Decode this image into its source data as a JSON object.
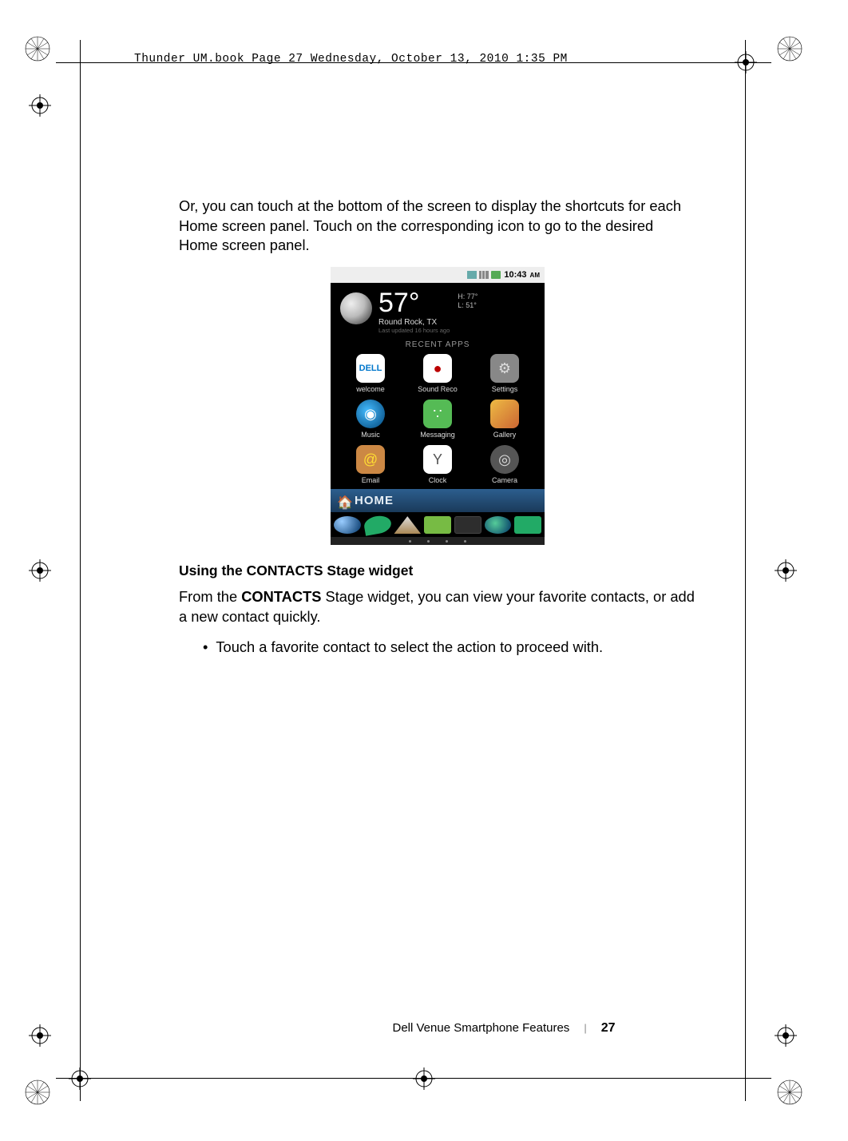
{
  "header": {
    "running_head": "Thunder_UM.book  Page 27  Wednesday, October 13, 2010  1:35 PM"
  },
  "body": {
    "para1": "Or, you can touch at the bottom of the screen to display the shortcuts for each Home screen panel. Touch on the corresponding icon to go to the desired Home screen panel.",
    "heading": "Using the CONTACTS Stage widget",
    "para2a": "From the ",
    "para2b": "CONTACTS",
    "para2c": " Stage widget, you can view your favorite contacts, or add a new contact quickly.",
    "bullet1": "Touch a favorite contact to select the action to proceed with."
  },
  "phone": {
    "status_time": "10:43",
    "status_ampm": "AM",
    "weather": {
      "temp": "57°",
      "hi": "H: 77°",
      "lo": "L: 51°",
      "location": "Round Rock, TX",
      "updated": "Last updated 16 hours ago"
    },
    "recent_label": "RECENT APPS",
    "apps": [
      {
        "name": "welcome",
        "label": "welcome"
      },
      {
        "name": "sound-rec",
        "label": "Sound Reco"
      },
      {
        "name": "settings",
        "label": "Settings"
      },
      {
        "name": "music",
        "label": "Music"
      },
      {
        "name": "messaging",
        "label": "Messaging"
      },
      {
        "name": "gallery",
        "label": "Gallery"
      },
      {
        "name": "email",
        "label": "Email"
      },
      {
        "name": "clock",
        "label": "Clock"
      },
      {
        "name": "camera",
        "label": "Camera"
      }
    ],
    "home_label": "HOME"
  },
  "footer": {
    "title": "Dell Venue Smartphone Features",
    "page": "27"
  }
}
